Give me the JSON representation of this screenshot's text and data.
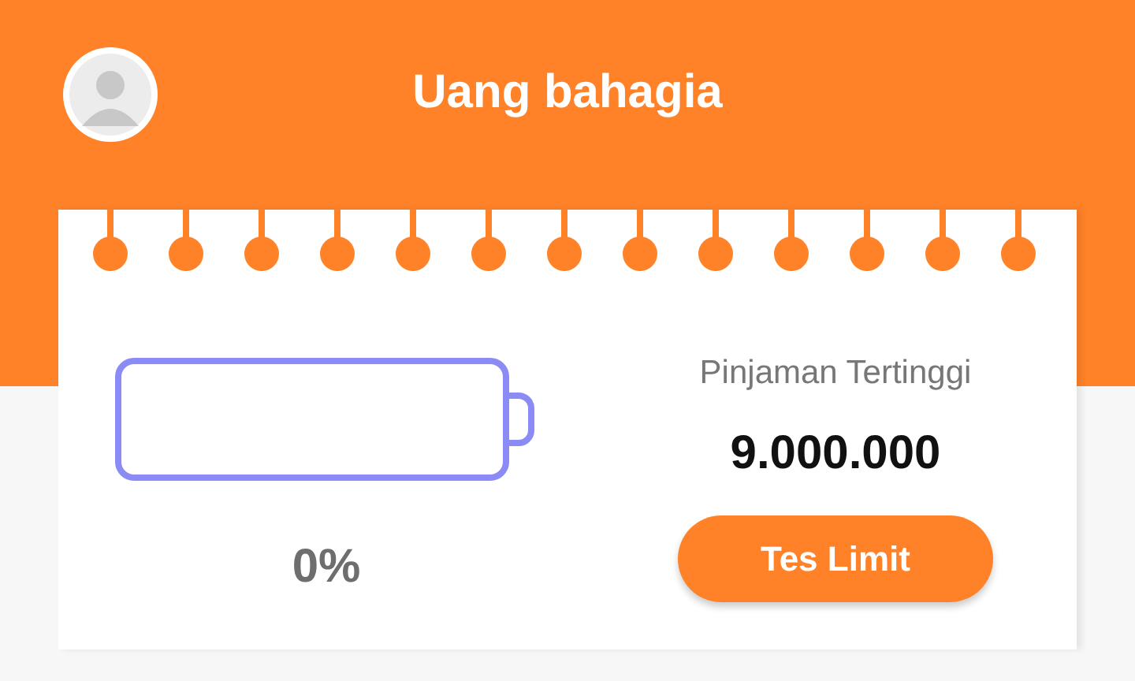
{
  "header": {
    "title": "Uang bahagia"
  },
  "card": {
    "percent": "0%",
    "limit_label": "Pinjaman Tertinggi",
    "limit_amount": "9.000.000",
    "button": "Tes Limit"
  }
}
